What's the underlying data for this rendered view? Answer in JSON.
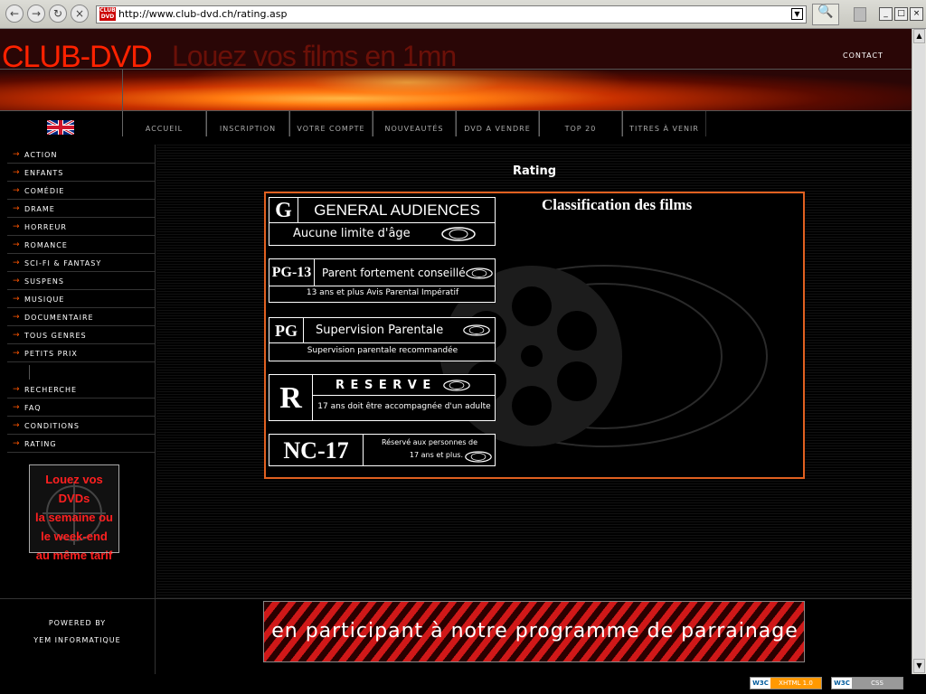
{
  "browser": {
    "url": "http://www.club-dvd.ch/rating.asp",
    "url_logo": "CLUB DVD"
  },
  "header": {
    "logo": "CLUB-DVD",
    "tagline": "Louez vos films en 1mn",
    "contact": "CONTACT"
  },
  "nav": [
    {
      "label": "ACCUEIL"
    },
    {
      "label": "INSCRIPTION"
    },
    {
      "label": "VOTRE COMPTE"
    },
    {
      "label": "NOUVEAUTÉS"
    },
    {
      "label": "DVD A VENDRE"
    },
    {
      "label": "TOP 20"
    },
    {
      "label": "TITRES À VENIR"
    }
  ],
  "sidebar": {
    "genres": [
      {
        "label": "ACTION"
      },
      {
        "label": "ENFANTS"
      },
      {
        "label": "COMÉDIE"
      },
      {
        "label": "DRAME"
      },
      {
        "label": "HORREUR"
      },
      {
        "label": "ROMANCE"
      },
      {
        "label": "SCI-FI & FANTASY"
      },
      {
        "label": "SUSPENS"
      },
      {
        "label": "MUSIQUE"
      },
      {
        "label": "DOCUMENTAIRE"
      },
      {
        "label": "TOUS GENRES"
      },
      {
        "label": "PETITS PRIX"
      }
    ],
    "tools": [
      {
        "label": "RECHERCHE"
      },
      {
        "label": "FAQ"
      },
      {
        "label": "CONDITIONS"
      },
      {
        "label": "RATING"
      }
    ],
    "promo": [
      "Louez vos DVDs",
      "la semaine ou",
      "le week-end",
      "au même tarif"
    ]
  },
  "main": {
    "title": "Rating",
    "panel_title": "Classification des films",
    "ratings": [
      {
        "code": "G",
        "name": "GENERAL AUDIENCES",
        "desc": "Aucune limite d'âge"
      },
      {
        "code": "PG-13",
        "name": "Parent fortement conseillé",
        "desc": "13 ans et plus Avis Parental Impératif"
      },
      {
        "code": "PG",
        "name": "Supervision Parentale",
        "desc": "Supervision parentale recommandée"
      },
      {
        "code": "R",
        "name": "R E S E R V E",
        "desc": "17 ans doit être accompagnée d'un adulte"
      },
      {
        "code": "NC-17",
        "name": "Réservé aux personnes de",
        "desc": "17 ans et plus."
      }
    ]
  },
  "footer": {
    "powered_line1": "POWERED BY",
    "powered_line2": "YEM INFORMATIQUE",
    "banner": "en participant à notre programme de parrainage"
  },
  "status": {
    "badge1": "XHTML 1.0",
    "badge2": "CSS",
    "badge_prefix": "W3C"
  },
  "colors": {
    "accent": "#e06020",
    "logo_red": "#ff2200",
    "promo_red": "#ff2020"
  }
}
